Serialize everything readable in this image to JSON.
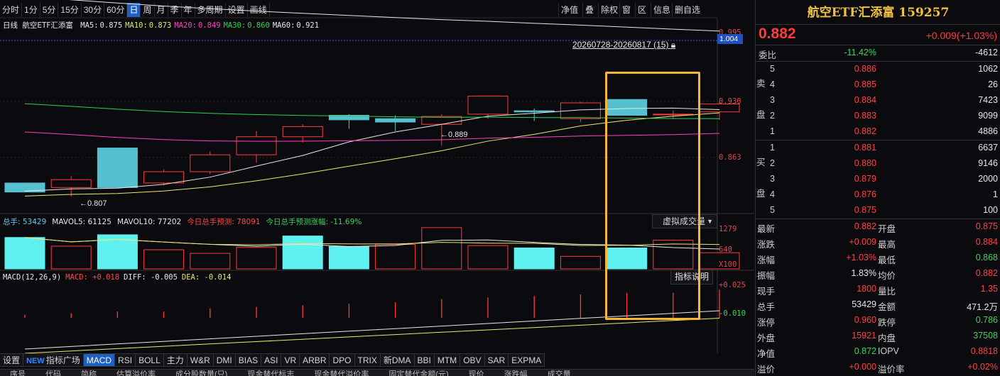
{
  "toolbar": {
    "periods": [
      "分时",
      "1分",
      "5分",
      "15分",
      "30分",
      "60分",
      "日",
      "周",
      "月",
      "季",
      "年",
      "多周期",
      "设置",
      "画线"
    ],
    "active_period": "日",
    "right_buttons": [
      "净值",
      "叠",
      "除权",
      "窗",
      "区",
      "信息",
      "删自选"
    ]
  },
  "kline": {
    "period_label": "日线",
    "name": "航空ETF汇添富",
    "ma": [
      {
        "label": "MA5:",
        "value": "0.875",
        "color": "#e8e8e8"
      },
      {
        "label": "MA10:",
        "value": "0.873",
        "color": "#e8e870"
      },
      {
        "label": "MA20:",
        "value": "0.849",
        "color": "#ff40c0"
      },
      {
        "label": "MA30:",
        "value": "0.860",
        "color": "#30d050"
      },
      {
        "label": "MA60:",
        "value": "0.921",
        "color": "#e8e8e8"
      }
    ],
    "range_label": "20260728-20260817 (15)",
    "y_labels": [
      "0.995",
      "0.930",
      "0.863"
    ],
    "current_price_tag": "1.004",
    "high_marker": "0.889",
    "low_marker": "0.807",
    "candles": [
      {
        "o": 0.812,
        "c": 0.804,
        "h": 0.812,
        "l": 0.804
      },
      {
        "o": 0.808,
        "c": 0.815,
        "h": 0.818,
        "l": 0.8
      },
      {
        "o": 0.843,
        "c": 0.808,
        "h": 0.843,
        "l": 0.808
      },
      {
        "o": 0.812,
        "c": 0.822,
        "h": 0.824,
        "l": 0.81
      },
      {
        "o": 0.822,
        "c": 0.837,
        "h": 0.84,
        "l": 0.82
      },
      {
        "o": 0.837,
        "c": 0.853,
        "h": 0.858,
        "l": 0.83
      },
      {
        "o": 0.853,
        "c": 0.862,
        "h": 0.864,
        "l": 0.848
      },
      {
        "o": 0.872,
        "c": 0.868,
        "h": 0.873,
        "l": 0.86
      },
      {
        "o": 0.869,
        "c": 0.866,
        "h": 0.872,
        "l": 0.858
      },
      {
        "o": 0.864,
        "c": 0.871,
        "h": 0.873,
        "l": 0.845
      },
      {
        "o": 0.873,
        "c": 0.889,
        "h": 0.889,
        "l": 0.869
      },
      {
        "o": 0.876,
        "c": 0.875,
        "h": 0.878,
        "l": 0.867
      },
      {
        "o": 0.869,
        "c": 0.883,
        "h": 0.884,
        "l": 0.866
      },
      {
        "o": 0.886,
        "c": 0.872,
        "h": 0.886,
        "l": 0.872
      },
      {
        "o": 0.873,
        "c": 0.873,
        "h": 0.876,
        "l": 0.869
      },
      {
        "o": 0.875,
        "c": 0.882,
        "h": 0.884,
        "l": 0.868
      }
    ]
  },
  "volume": {
    "legend": [
      {
        "text": "总手: 53429",
        "color": "#5fd0f0"
      },
      {
        "text": "MAVOL5: 61125",
        "color": "#e8e8e8"
      },
      {
        "text": "MAVOL10: 77202",
        "color": "#e8e8e8"
      },
      {
        "text": "今日总手预测: 78091",
        "color": "#ff4848"
      },
      {
        "text": "今日总手预测涨幅: -11.69%",
        "color": "#3fd35c"
      }
    ],
    "y_labels": [
      "1279",
      "640",
      "X100"
    ],
    "virtual_btn": "虚拟成交量",
    "bars": [
      {
        "v": 1050,
        "up": false
      },
      {
        "v": 760,
        "up": true
      },
      {
        "v": 1140,
        "up": false
      },
      {
        "v": 640,
        "up": true
      },
      {
        "v": 520,
        "up": true
      },
      {
        "v": 720,
        "up": true
      },
      {
        "v": 1100,
        "up": false
      },
      {
        "v": 750,
        "up": false
      },
      {
        "v": 820,
        "up": true
      },
      {
        "v": 1380,
        "up": true
      },
      {
        "v": 780,
        "up": true
      },
      {
        "v": 700,
        "up": false
      },
      {
        "v": 420,
        "up": true
      },
      {
        "v": 700,
        "up": false
      },
      {
        "v": 960,
        "up": true
      },
      {
        "v": 540,
        "up": true
      }
    ]
  },
  "macd": {
    "legend": [
      {
        "text": "MACD(12,26,9)",
        "color": "#e8e8e8"
      },
      {
        "text": "MACD: +0.018",
        "color": "#ff4848"
      },
      {
        "text": "DIFF: -0.005",
        "color": "#e8e8e8"
      },
      {
        "text": "DEA: -0.014",
        "color": "#e8e870"
      }
    ],
    "y_labels": [
      "+0.025",
      "-0.010"
    ],
    "indicator_btn": "指标说明",
    "bars": [
      0.002,
      0.003,
      0.004,
      0.004,
      0.006,
      0.007,
      0.008,
      0.009,
      0.01,
      0.012,
      0.013,
      0.014,
      0.015,
      0.016,
      0.016,
      0.018
    ]
  },
  "indicator_tabs": [
    "设置",
    "NEW指标广场",
    "MACD",
    "RSI",
    "BOLL",
    "主力",
    "W&R",
    "DMI",
    "BIAS",
    "ASI",
    "VR",
    "ARBR",
    "DPO",
    "TRIX",
    "新DMA",
    "BBI",
    "MTM",
    "OBV",
    "SAR",
    "EXPMA"
  ],
  "active_tab": "MACD",
  "bottom_header": [
    "序号",
    "代码",
    "简称",
    "估算溢价率",
    "成分股数量(只)",
    "现金替代标志",
    "现金替代溢价率",
    "固定替代金额(元)",
    "现价",
    "涨跌幅",
    "成交量"
  ],
  "quote": {
    "title": "航空ETF汇添富 159257",
    "price": "0.882",
    "change": "+0.009(+1.03%)",
    "weibi_label": "委比",
    "weibi_pct": "-11.42%",
    "weibi_val": "-4612",
    "sell_label": [
      "卖",
      "盘"
    ],
    "buy_label": [
      "买",
      "盘"
    ],
    "asks": [
      {
        "lvl": "5",
        "p": "0.886",
        "v": "1062"
      },
      {
        "lvl": "4",
        "p": "0.885",
        "v": "26"
      },
      {
        "lvl": "3",
        "p": "0.884",
        "v": "7423"
      },
      {
        "lvl": "2",
        "p": "0.883",
        "v": "9099"
      },
      {
        "lvl": "1",
        "p": "0.882",
        "v": "4886"
      }
    ],
    "bids": [
      {
        "lvl": "1",
        "p": "0.881",
        "v": "6637"
      },
      {
        "lvl": "2",
        "p": "0.880",
        "v": "9146"
      },
      {
        "lvl": "3",
        "p": "0.879",
        "v": "2000"
      },
      {
        "lvl": "4",
        "p": "0.876",
        "v": "1"
      },
      {
        "lvl": "5",
        "p": "0.875",
        "v": "100"
      }
    ],
    "stats": [
      {
        "l1": "最新",
        "v1": "0.882",
        "c1": "red",
        "l2": "开盘",
        "v2": "0.875",
        "c2": "red"
      },
      {
        "l1": "涨跌",
        "v1": "+0.009",
        "c1": "red",
        "l2": "最高",
        "v2": "0.884",
        "c2": "red"
      },
      {
        "l1": "涨幅",
        "v1": "+1.03%",
        "c1": "red",
        "l2": "最低",
        "v2": "0.868",
        "c2": "green"
      },
      {
        "l1": "振幅",
        "v1": "1.83%",
        "c1": "white",
        "l2": "均价",
        "v2": "0.882",
        "c2": "red"
      },
      {
        "l1": "现手",
        "v1": "1800",
        "c1": "red",
        "l2": "量比",
        "v2": "1.35",
        "c2": "red"
      },
      {
        "l1": "总手",
        "v1": "53429",
        "c1": "white",
        "l2": "金额",
        "v2": "471.2万",
        "c2": "white"
      },
      {
        "l1": "涨停",
        "v1": "0.960",
        "c1": "red",
        "l2": "跌停",
        "v2": "0.786",
        "c2": "green"
      },
      {
        "l1": "外盘",
        "v1": "15921",
        "c1": "red",
        "l2": "内盘",
        "v2": "37508",
        "c2": "green"
      },
      {
        "l1": "净值",
        "v1": "0.872",
        "c1": "green",
        "l2": "IOPV",
        "v2": "0.8818",
        "c2": "red"
      },
      {
        "l1": "溢价",
        "v1": "+0.000",
        "c1": "red",
        "l2": "溢价率",
        "v2": "+0.02%",
        "c2": "red"
      }
    ]
  }
}
